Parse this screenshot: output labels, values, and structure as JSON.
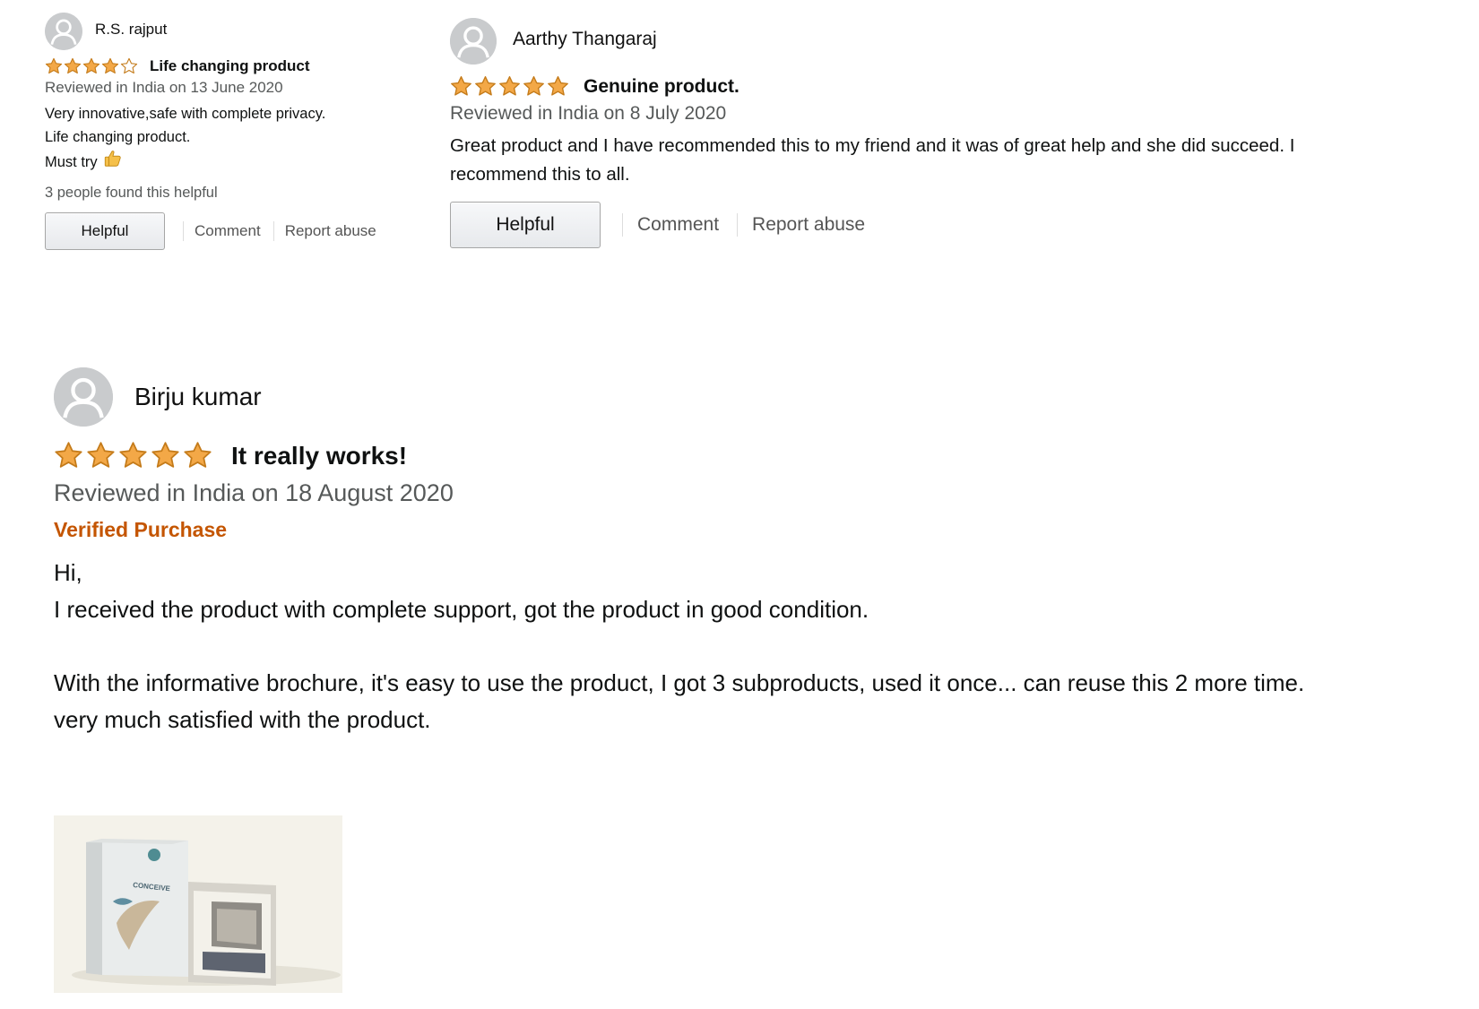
{
  "reviews": [
    {
      "reviewer": "R.S. rajput",
      "rating": 4,
      "rating_max": 5,
      "title": "Life changing product",
      "date_line": "Reviewed in India on 13 June 2020",
      "body_lines": [
        "Very innovative,safe with complete privacy.",
        "Life changing product.",
        "Must try"
      ],
      "helpful_count_text": "3 people found this helpful",
      "helpful_button": "Helpful",
      "comment_link": "Comment",
      "report_link": "Report abuse"
    },
    {
      "reviewer": "Aarthy Thangaraj",
      "rating": 5,
      "rating_max": 5,
      "title": "Genuine product.",
      "date_line": "Reviewed in India on 8 July 2020",
      "body": "Great product and I have recommended this to my friend and it was of great help and she did succeed. I recommend this to all.",
      "helpful_button": "Helpful",
      "comment_link": "Comment",
      "report_link": "Report abuse"
    },
    {
      "reviewer": "Birju kumar",
      "rating": 5,
      "rating_max": 5,
      "title": "It really works!",
      "date_line": "Reviewed in India on 18 August 2020",
      "verified": "Verified Purchase",
      "body_lines": [
        "Hi,",
        "I received the product with complete support, got the product in good condition.",
        "",
        "With the informative brochure, it's easy to use the product, I got 3 subproducts, used it once... can reuse this 2 more time.",
        "very much satisfied with the product."
      ],
      "image_text": "CONCEIVE"
    }
  ],
  "colors": {
    "star_fill": "#f3a847",
    "star_stroke": "#c47b1a",
    "verified": "#c45500",
    "avatar_bg": "#c9cbcd"
  },
  "icons": {
    "avatar": "default-user-avatar-icon",
    "star": "star-icon",
    "thumbs_up": "thumbs-up-emoji"
  }
}
